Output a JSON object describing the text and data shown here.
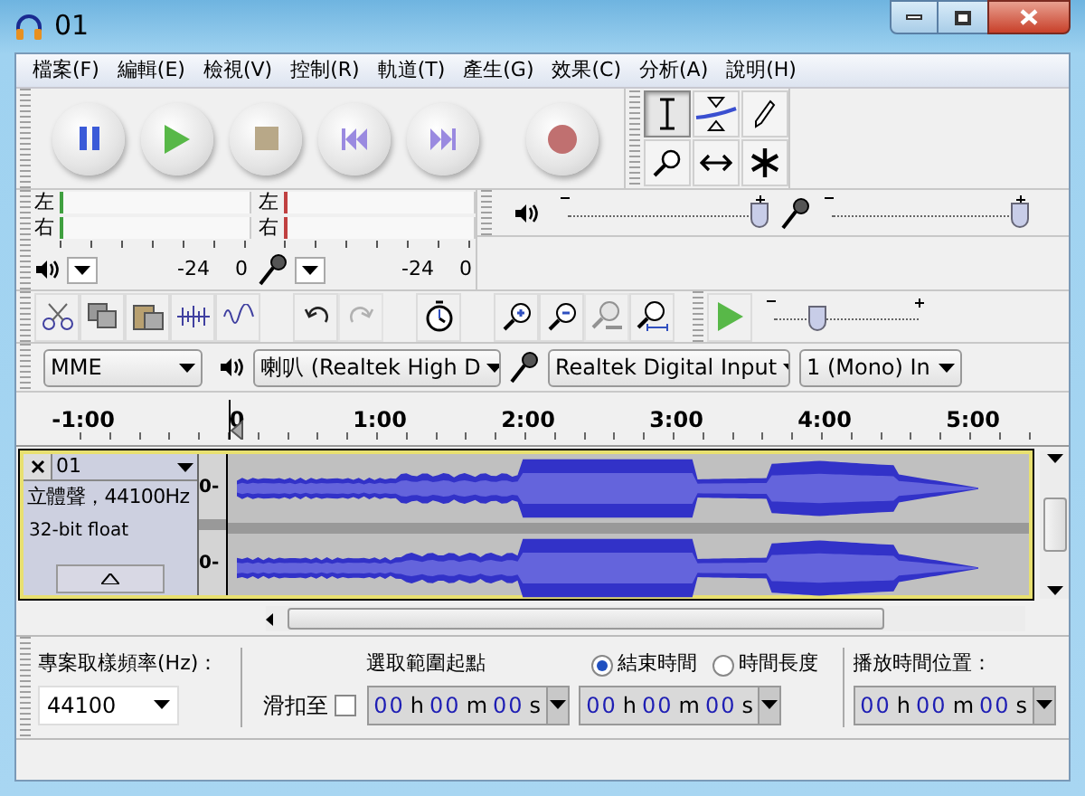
{
  "window": {
    "title": "01"
  },
  "menu": [
    "檔案(F)",
    "編輯(E)",
    "檢視(V)",
    "控制(R)",
    "軌道(T)",
    "產生(G)",
    "效果(C)",
    "分析(A)",
    "說明(H)"
  ],
  "tools": [
    {
      "selected": true
    },
    {
      "selected": false
    },
    {
      "selected": false
    },
    {
      "selected": false
    },
    {
      "selected": false
    },
    {
      "selected": false
    }
  ],
  "meters": [
    {
      "labels": [
        "左",
        "右"
      ],
      "scale": [
        "-24",
        "0"
      ]
    },
    {
      "labels": [
        "左",
        "右"
      ],
      "scale": [
        "-24",
        "0"
      ]
    }
  ],
  "mixer": [
    {
      "level": 1.0
    },
    {
      "level": 1.0
    }
  ],
  "play_at_speed": {
    "level": 0.3
  },
  "devices": {
    "host": "MME",
    "output": "喇叭 (Realtek High D",
    "input": "Realtek Digital Input",
    "channels": "1 (Mono) In"
  },
  "ruler": [
    "-1:00",
    "0",
    "1:00",
    "2:00",
    "3:00",
    "4:00",
    "5:00"
  ],
  "track": {
    "name": "01",
    "format": "立體聲，44100Hz",
    "sample_format": "32-bit float",
    "channel_scales": [
      "0-",
      "0-"
    ]
  },
  "selection_bar": {
    "rate_label": "專案取樣頻率(Hz)：",
    "rate": "44100",
    "snap_label": "滑扣至",
    "snap": false,
    "start_label": "選取範圍起點",
    "options": [
      {
        "label": "結束時間",
        "selected": true
      },
      {
        "label": "時間長度",
        "selected": false
      }
    ],
    "position_label": "播放時間位置：",
    "times": [
      {
        "parts": [
          {
            "v": "00",
            "u": "h"
          },
          {
            "v": "00",
            "u": "m"
          },
          {
            "v": "00",
            "u": "s"
          }
        ]
      },
      {
        "parts": [
          {
            "v": "00",
            "u": "h"
          },
          {
            "v": "00",
            "u": "m"
          },
          {
            "v": "00",
            "u": "s"
          }
        ]
      },
      {
        "parts": [
          {
            "v": "00",
            "u": "h"
          },
          {
            "v": "00",
            "u": "m"
          },
          {
            "v": "00",
            "u": "s"
          }
        ]
      }
    ]
  }
}
